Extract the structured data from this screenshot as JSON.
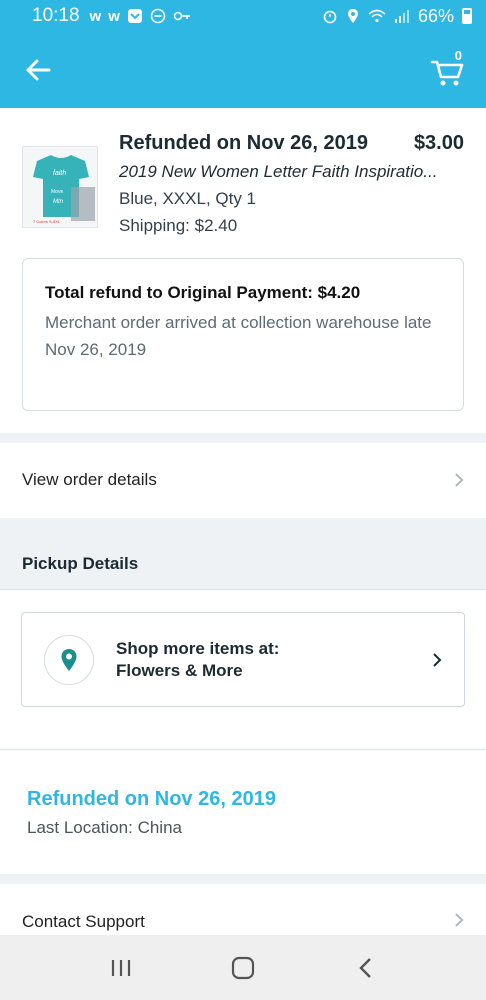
{
  "status_bar": {
    "time": "10:18",
    "battery": "66%",
    "left_icons": [
      "w-app-icon",
      "w-app-icon",
      "shield-app-icon",
      "do-not-disturb-icon",
      "key-icon"
    ],
    "right_icons": [
      "alarm-icon",
      "location-icon",
      "wifi-icon",
      "signal-icon",
      "battery-icon"
    ]
  },
  "header": {
    "back_icon": "arrow-left-icon",
    "cart_icon": "cart-icon",
    "cart_count": "0",
    "accent_color": "#2fb7e4"
  },
  "item": {
    "status": "Refunded on Nov 26, 2019",
    "price": "$3.00",
    "name": "2019 New Women Letter Faith Inspiratio...",
    "variant": "Blue, XXXL, Qty 1",
    "shipping": "Shipping: $2.40"
  },
  "refund": {
    "total": "Total refund to Original Payment: $4.20",
    "reason": "Merchant order arrived at collection warehouse late",
    "date": "Nov 26, 2019"
  },
  "order_details": {
    "label": "View order details"
  },
  "pickup": {
    "header": "Pickup Details",
    "shop_line1": "Shop more items at:",
    "shop_line2": "Flowers & More"
  },
  "tracking": {
    "status": "Refunded on Nov 26, 2019",
    "location": "Last Location: China"
  },
  "support": {
    "label": "Contact Support"
  },
  "nav": {
    "icons": [
      "recent-apps-icon",
      "home-icon",
      "back-icon"
    ]
  }
}
